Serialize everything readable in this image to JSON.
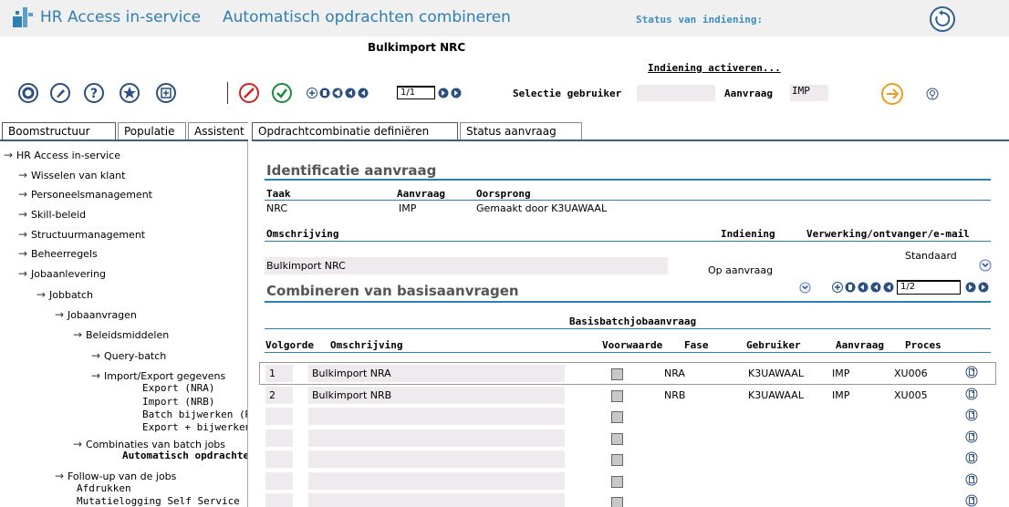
{
  "header": {
    "app_title": "HR Access in-service",
    "page_title": "Automatisch opdrachten combineren",
    "status_label": "Status van indiening:",
    "subtitle": "Bulkimport NRC",
    "activate_link": "Indiening activeren..."
  },
  "toolbar": {
    "pager_value": "1/1",
    "selection_user_label": "Selectie gebruiker",
    "selection_user_value": "",
    "request_label": "Aanvraag",
    "request_value": "IMP"
  },
  "left_tabs": [
    "Boomstructuur",
    "Populatie",
    "Assistent"
  ],
  "right_tabs": [
    "Opdrachtcombinatie definiëren",
    "Status aanvraag"
  ],
  "tree": [
    {
      "label": "HR Access in-service",
      "level": 0,
      "arrow": true
    },
    {
      "label": "Wisselen van klant",
      "level": 1,
      "arrow": true
    },
    {
      "label": "Personeelsmanagement",
      "level": 1,
      "arrow": true
    },
    {
      "label": "Skill-beleid",
      "level": 1,
      "arrow": true
    },
    {
      "label": "Structuurmanagement",
      "level": 1,
      "arrow": true
    },
    {
      "label": "Beheerregels",
      "level": 1,
      "arrow": true
    },
    {
      "label": "Jobaanlevering",
      "level": 1,
      "arrow": true
    },
    {
      "label": "Jobbatch",
      "level": 2,
      "arrow": true
    },
    {
      "label": "Jobaanvragen",
      "level": 3,
      "arrow": true
    },
    {
      "label": "Beleidsmiddelen",
      "level": 4,
      "arrow": true
    },
    {
      "label": "Query-batch",
      "level": 5,
      "arrow": true
    },
    {
      "label": "Import/Export gegevens",
      "level": 5,
      "arrow": true
    },
    {
      "label": "Export (NRA)",
      "level": 6,
      "arrow": false
    },
    {
      "label": "Import (NRB)",
      "level": 6,
      "arrow": false
    },
    {
      "label": "Batch bijwerken (RE)",
      "level": 6,
      "arrow": false
    },
    {
      "label": "Export + bijwerken",
      "level": 6,
      "arrow": false
    },
    {
      "label": "Combinaties van batch jobs",
      "level": 4,
      "arrow": true
    },
    {
      "label": "Automatisch opdrachten",
      "level": 5,
      "arrow": false,
      "bold": true
    },
    {
      "label": "Follow-up van de jobs",
      "level": 3,
      "arrow": true
    },
    {
      "label": "Afdrukken",
      "level": 4,
      "arrow": false
    },
    {
      "label": "Mutatielogging Self Service",
      "level": 4,
      "arrow": false
    }
  ],
  "identification": {
    "title": "Identificatie aanvraag",
    "col_taak": "Taak",
    "col_aanvraag": "Aanvraag",
    "col_oorsprong": "Oorsprong",
    "taak": "NRC",
    "aanvraag": "IMP",
    "oorsprong": "Gemaakt door K3UAWAAL",
    "col_omschrijving": "Omschrijving",
    "col_indiening": "Indiening",
    "col_verwerking": "Verwerking/ontvanger/e-mail",
    "verwerking_value": "Standaard",
    "omschrijving": "Bulkimport NRC",
    "indiening": "Op aanvraag"
  },
  "combine": {
    "title": "Combineren van basisaanvragen",
    "pager_value": "1/2",
    "group_header": "Basisbatchjobaanvraag",
    "columns": {
      "volgorde": "Volgorde",
      "omschrijving": "Omschrijving",
      "voorwaarde": "Voorwaarde",
      "fase": "Fase",
      "gebruiker": "Gebruiker",
      "aanvraag": "Aanvraag",
      "proces": "Proces"
    },
    "rows": [
      {
        "volgorde": "1",
        "omschrijving": "Bulkimport NRA",
        "fase": "NRA",
        "gebruiker": "K3UAWAAL",
        "aanvraag": "IMP",
        "proces": "XU006"
      },
      {
        "volgorde": "2",
        "omschrijving": "Bulkimport NRB",
        "fase": "NRB",
        "gebruiker": "K3UAWAAL",
        "aanvraag": "IMP",
        "proces": "XU005"
      },
      {
        "volgorde": "",
        "omschrijving": "",
        "fase": "",
        "gebruiker": "",
        "aanvraag": "",
        "proces": ""
      },
      {
        "volgorde": "",
        "omschrijving": "",
        "fase": "",
        "gebruiker": "",
        "aanvraag": "",
        "proces": ""
      },
      {
        "volgorde": "",
        "omschrijving": "",
        "fase": "",
        "gebruiker": "",
        "aanvraag": "",
        "proces": ""
      },
      {
        "volgorde": "",
        "omschrijving": "",
        "fase": "",
        "gebruiker": "",
        "aanvraag": "",
        "proces": ""
      },
      {
        "volgorde": "",
        "omschrijving": "",
        "fase": "",
        "gebruiker": "",
        "aanvraag": "",
        "proces": ""
      }
    ]
  },
  "colors": {
    "accent": "#2f7fb0",
    "field_bg": "#eeeaee",
    "tab_line": "#3b5f8a"
  }
}
